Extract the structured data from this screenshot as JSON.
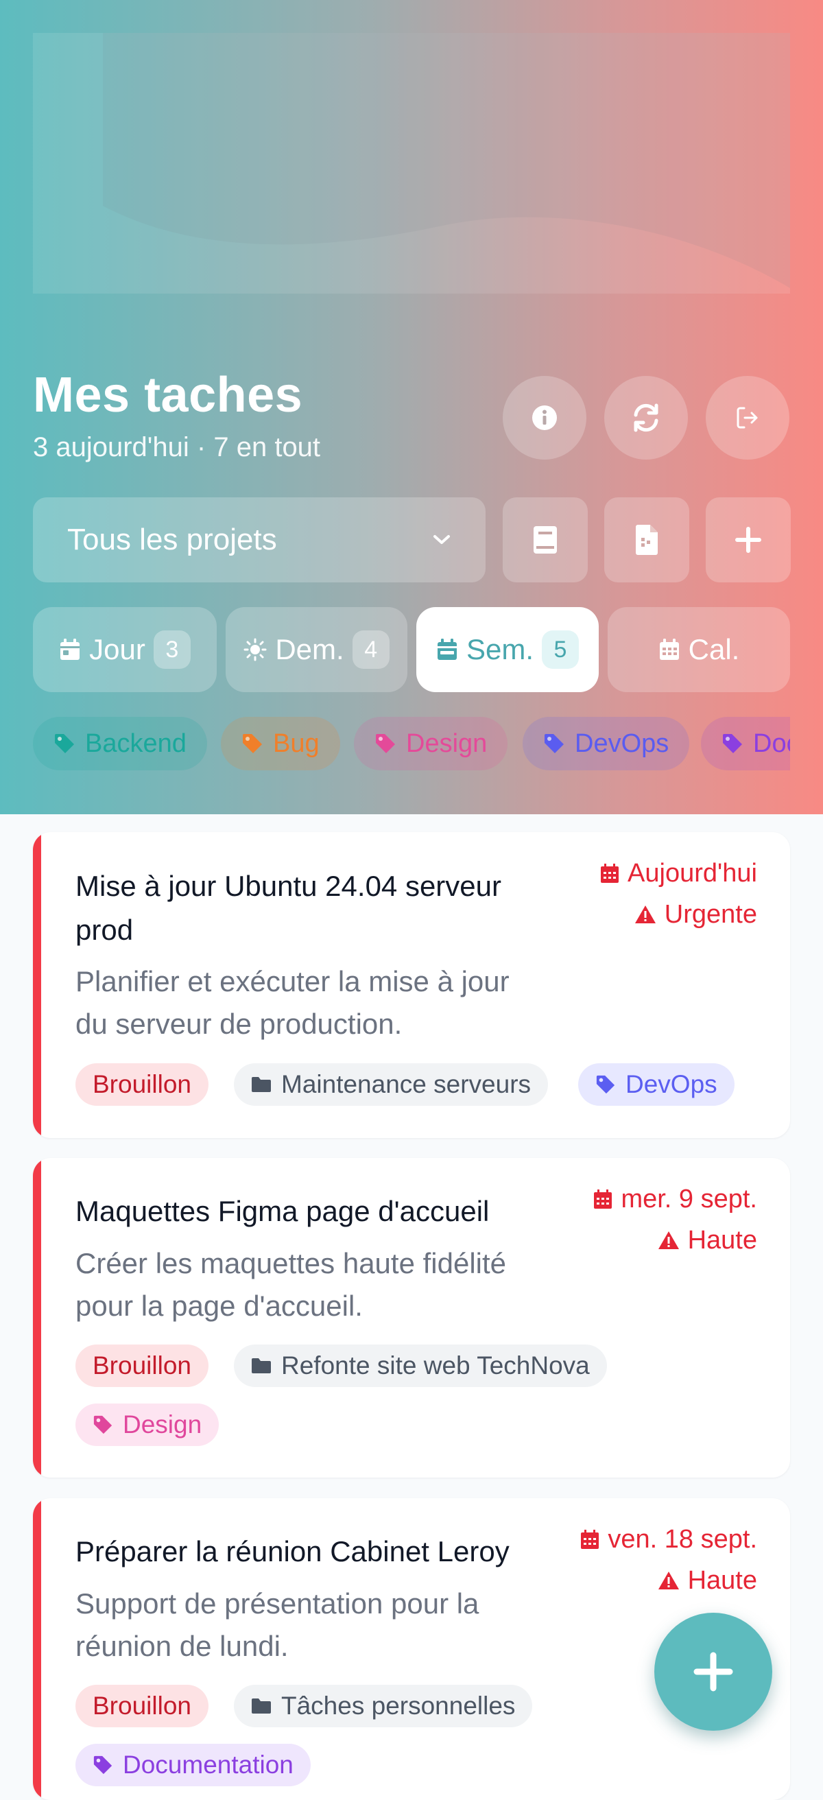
{
  "header": {
    "title": "Mes taches",
    "summary": "3 aujourd'hui · 7 en tout"
  },
  "actions": {
    "info_icon": "info-circle-icon",
    "refresh_icon": "sync-icon",
    "logout_icon": "sign-out-icon"
  },
  "project_filter": {
    "selected": "Tous les projets",
    "book_icon": "book-icon",
    "export_icon": "file-export-icon",
    "add_icon": "plus-icon"
  },
  "views": [
    {
      "label": "Jour",
      "count": "3",
      "icon": "calendar-day-icon",
      "active": false
    },
    {
      "label": "Dem.",
      "count": "4",
      "icon": "sun-icon",
      "active": false
    },
    {
      "label": "Sem.",
      "count": "5",
      "icon": "calendar-week-icon",
      "active": true
    },
    {
      "label": "Cal.",
      "icon": "calendar-grid-icon",
      "active": false
    }
  ],
  "tags": [
    {
      "label": "Backend",
      "color": "#1aa89b"
    },
    {
      "label": "Bug",
      "color": "#f07f2a"
    },
    {
      "label": "Design",
      "color": "#e44a99"
    },
    {
      "label": "DevOps",
      "color": "#5a5cf0"
    },
    {
      "label": "Documentation",
      "color": "#8b3fe0"
    }
  ],
  "tasks": [
    {
      "title_line1": "Mise à jour Ubuntu 24.04 serveur",
      "title_line2": "prod",
      "desc_line1": "Planifier et exécuter la mise à jour",
      "desc_line2": "du serveur de production.",
      "due": "Aujourd'hui",
      "priority": "Urgente",
      "status": "Brouillon",
      "project": "Maintenance serveurs",
      "tag": "DevOps"
    },
    {
      "title_line1": "Maquettes Figma page d'accueil",
      "desc_line1": "Créer les maquettes haute fidélité",
      "desc_line2": "pour la page d'accueil.",
      "due": "mer. 9 sept.",
      "priority": "Haute",
      "status": "Brouillon",
      "project": "Refonte site web TechNova",
      "tag": "Design"
    },
    {
      "title_line1": "Préparer la réunion Cabinet Leroy",
      "desc_line1": "Support de présentation pour la",
      "desc_line2": "réunion de lundi.",
      "due": "ven. 18 sept.",
      "priority": "Haute",
      "status": "Brouillon",
      "project": "Tâches personnelles",
      "tag": "Documentation"
    }
  ],
  "colors": {
    "accent": "#5dbbbe",
    "urgent": "#e52535",
    "gradient_start": "#5dbcbf",
    "gradient_end": "#f88a84"
  },
  "fab_icon": "plus-icon"
}
